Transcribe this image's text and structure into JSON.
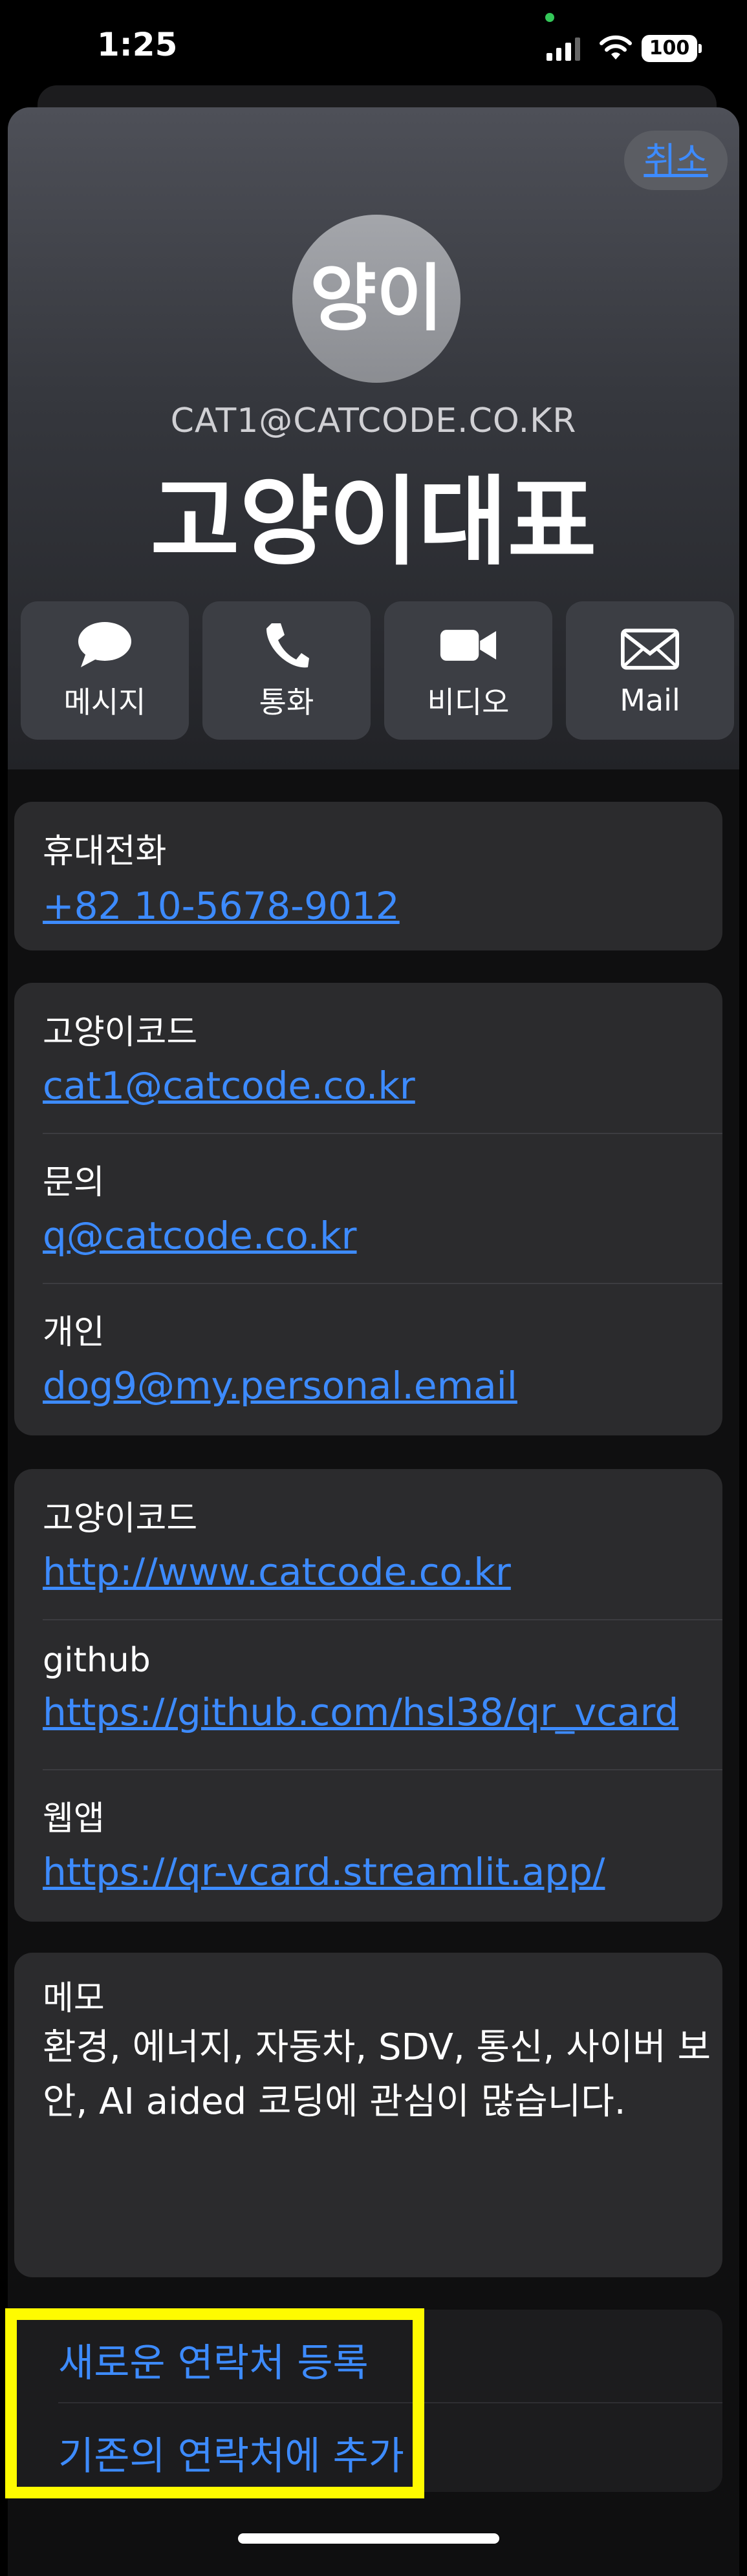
{
  "status_bar": {
    "time": "1:25",
    "battery": "100",
    "icons": [
      "cellular-signal-icon",
      "wifi-icon",
      "battery-icon"
    ]
  },
  "header": {
    "cancel_label": "취소"
  },
  "contact": {
    "avatar_initials": "양이",
    "email_caps": "CAT1@CATCODE.CO.KR",
    "name": "고양이대표"
  },
  "actions": [
    {
      "label": "메시지",
      "icon": "message-icon"
    },
    {
      "label": "통화",
      "icon": "phone-icon"
    },
    {
      "label": "비디오",
      "icon": "video-icon"
    },
    {
      "label": "Mail",
      "icon": "mail-icon"
    }
  ],
  "phone": {
    "label": "휴대전화",
    "value": "+82 10-5678-9012"
  },
  "emails": [
    {
      "label": "고양이코드",
      "value": "cat1@catcode.co.kr"
    },
    {
      "label": "문의",
      "value": "q@catcode.co.kr"
    },
    {
      "label": "개인",
      "value": "dog9@my.personal.email"
    }
  ],
  "urls": [
    {
      "label": "고양이코드",
      "value": "http://www.catcode.co.kr"
    },
    {
      "label": "github",
      "value": "https://github.com/hsl38/qr_vcard"
    },
    {
      "label": "웹앱",
      "value": "https://qr-vcard.streamlit.app/"
    }
  ],
  "memo": {
    "label": "메모",
    "text": "환경, 에너지, 자동차, SDV, 통신, 사이버 보안, AI aided 코딩에 관심이 많습니다."
  },
  "bottom_actions": {
    "create_new": "새로운 연락처 등록",
    "add_existing": "기존의 연락처에 추가"
  },
  "colors": {
    "accent": "#3d8bff",
    "highlight": "#fffb00",
    "card_bg": "#2b2b2d"
  }
}
